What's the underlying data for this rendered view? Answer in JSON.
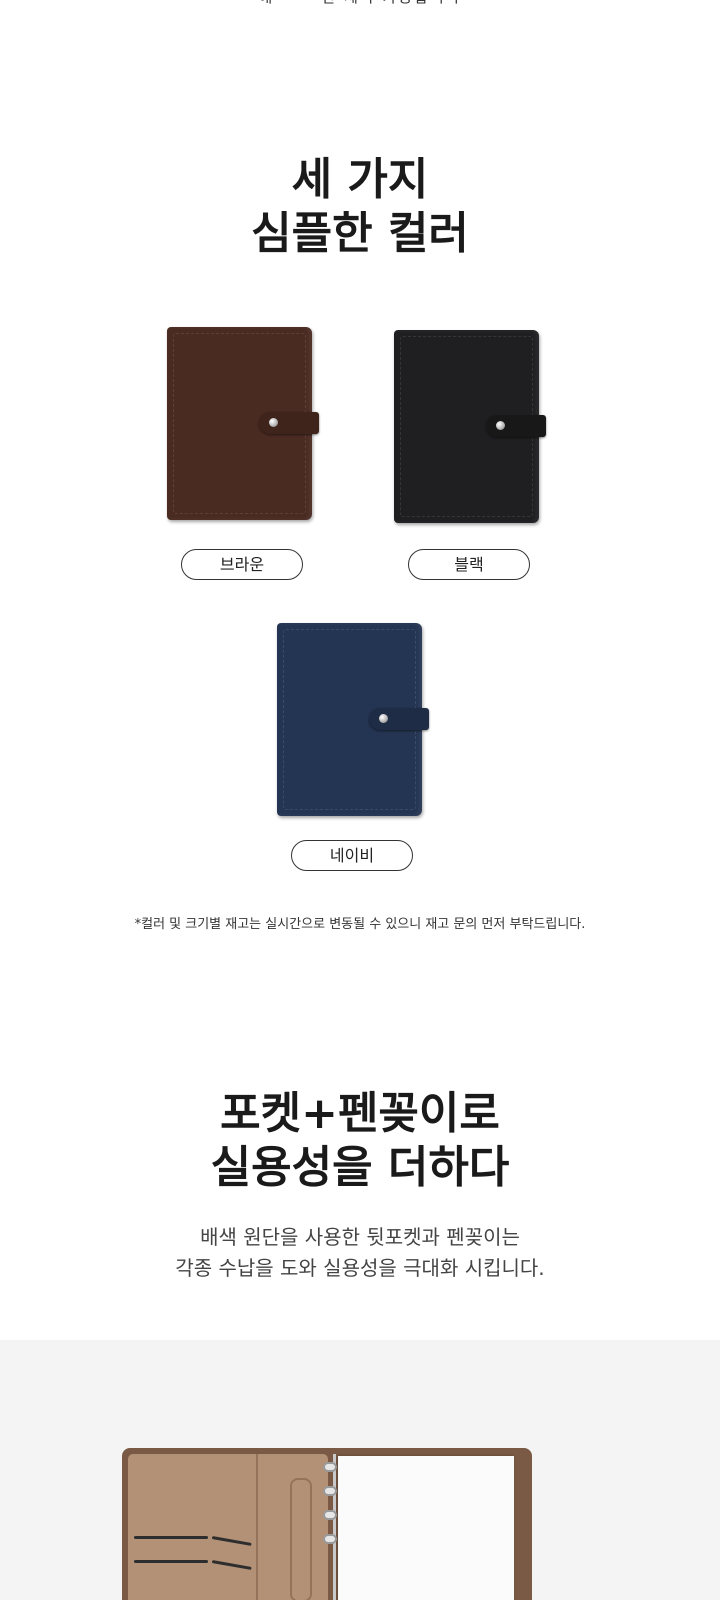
{
  "top_clipped_text": "해 · · · 한 제작 가능합니다",
  "section_colors": {
    "title_line1": "세 가지",
    "title_line2": "심플한 컬러",
    "options": [
      {
        "label": "브라운",
        "cover": "#4a2b22",
        "strap": "#3f241c"
      },
      {
        "label": "블랙",
        "cover": "#1f1f21",
        "strap": "#181818"
      },
      {
        "label": "네이비",
        "cover": "#243553",
        "strap": "#1e2c46"
      }
    ],
    "note": "*컬러 및 크기별 재고는 실시간으로 변동될 수 있으니 재고 문의 먼저 부탁드립니다."
  },
  "section_pocket": {
    "title_line1": "포켓+펜꽂이로",
    "title_line2": "실용성을 더하다",
    "desc_line1": "배색 원단을 사용한 뒷포켓과 펜꽂이는",
    "desc_line2": "각종 수납을 도와 실용성을 극대화 시킵니다."
  },
  "colors": {
    "photo_bg": "#f4f4f4",
    "binder_outer": "#7a5a44",
    "binder_inner": "#b39177"
  }
}
